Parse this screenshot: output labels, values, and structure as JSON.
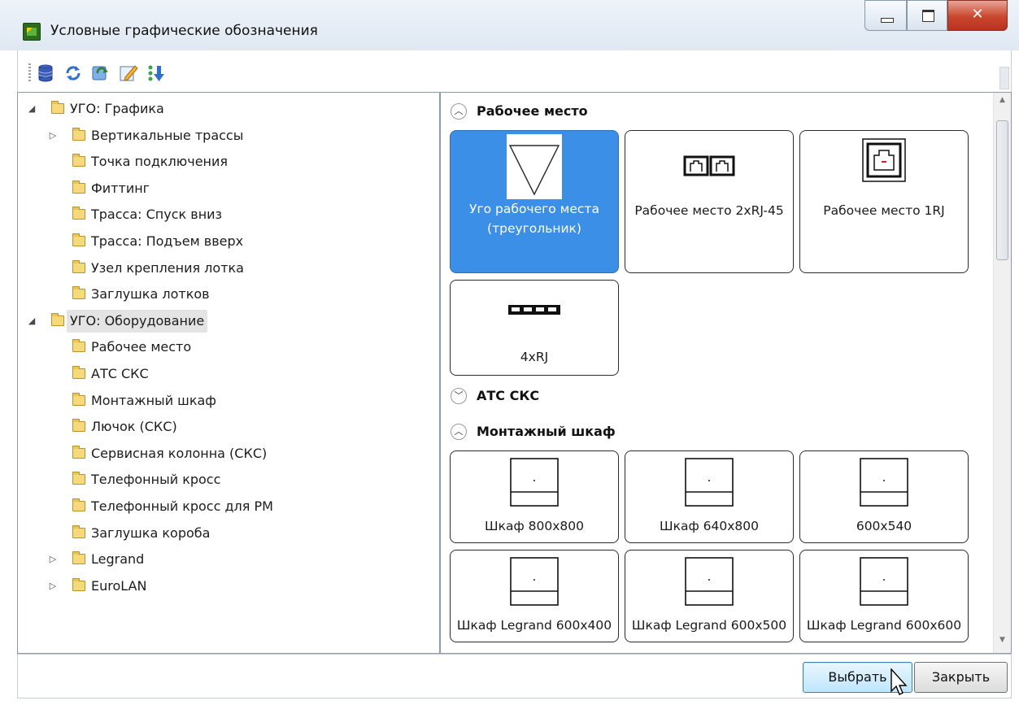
{
  "window": {
    "title": "Условные графические обозначения",
    "controls": {
      "minimize": "minimize-icon",
      "maximize": "maximize-icon",
      "close": "✕"
    }
  },
  "toolbar": {
    "icons": [
      "database-icon",
      "refresh-icon",
      "update-icon",
      "edit-icon",
      "sort-icon"
    ]
  },
  "tree": {
    "items": [
      {
        "label": "УГО: Графика",
        "level": 0,
        "expander": "expanded"
      },
      {
        "label": "Вертикальные трассы",
        "level": 1,
        "expander": "collapsed"
      },
      {
        "label": "Точка подключения",
        "level": 1,
        "expander": "none"
      },
      {
        "label": "Фиттинг",
        "level": 1,
        "expander": "none"
      },
      {
        "label": "Трасса: Спуск вниз",
        "level": 1,
        "expander": "none"
      },
      {
        "label": "Трасса: Подъем вверх",
        "level": 1,
        "expander": "none"
      },
      {
        "label": "Узел крепления лотка",
        "level": 1,
        "expander": "none"
      },
      {
        "label": "Заглушка лотков",
        "level": 1,
        "expander": "none"
      },
      {
        "label": "УГО: Оборудование",
        "level": 0,
        "expander": "expanded",
        "selected": true
      },
      {
        "label": "Рабочее место",
        "level": 1,
        "expander": "none"
      },
      {
        "label": "АТС СКС",
        "level": 1,
        "expander": "none"
      },
      {
        "label": "Монтажный шкаф",
        "level": 1,
        "expander": "none"
      },
      {
        "label": "Лючок (СКС)",
        "level": 1,
        "expander": "none"
      },
      {
        "label": "Сервисная колонна (СКС)",
        "level": 1,
        "expander": "none"
      },
      {
        "label": "Телефонный кросс",
        "level": 1,
        "expander": "none"
      },
      {
        "label": "Телефонный кросс для РМ",
        "level": 1,
        "expander": "none"
      },
      {
        "label": "Заглушка короба",
        "level": 1,
        "expander": "none"
      },
      {
        "label": "Legrand",
        "level": 1,
        "expander": "collapsed"
      },
      {
        "label": "EuroLAN",
        "level": 1,
        "expander": "collapsed"
      }
    ]
  },
  "gallery": {
    "sections": [
      {
        "title": "Рабочее место",
        "expanded": true,
        "tiles": [
          {
            "label": "Уго рабочего места (треугольник)",
            "icon": "triangle-symbol",
            "selected": true
          },
          {
            "label": "Рабочее место 2xRJ-45",
            "icon": "double-socket-symbol"
          },
          {
            "label": "Рабочее место 1RJ",
            "icon": "single-socket-symbol"
          },
          {
            "label": "4xRJ",
            "icon": "quad-socket-symbol"
          }
        ]
      },
      {
        "title": "АТС СКС",
        "expanded": false,
        "tiles": []
      },
      {
        "title": "Монтажный шкаф",
        "expanded": true,
        "tiles": [
          {
            "label": "Шкаф 800x800",
            "icon": "cabinet-symbol"
          },
          {
            "label": "Шкаф 640x800",
            "icon": "cabinet-symbol"
          },
          {
            "label": "600x540",
            "icon": "cabinet-symbol"
          },
          {
            "label": "Шкаф Legrand 600x400",
            "icon": "cabinet-symbol"
          },
          {
            "label": "Шкаф Legrand 600x500",
            "icon": "cabinet-symbol"
          },
          {
            "label": "Шкаф Legrand 600x600",
            "icon": "cabinet-symbol"
          }
        ]
      }
    ]
  },
  "footer": {
    "select_label": "Выбрать",
    "close_label": "Закрыть"
  },
  "colors": {
    "selection": "#3b8fe6",
    "close_button": "#c9462d",
    "tree_selection": "#e4e4e4"
  }
}
